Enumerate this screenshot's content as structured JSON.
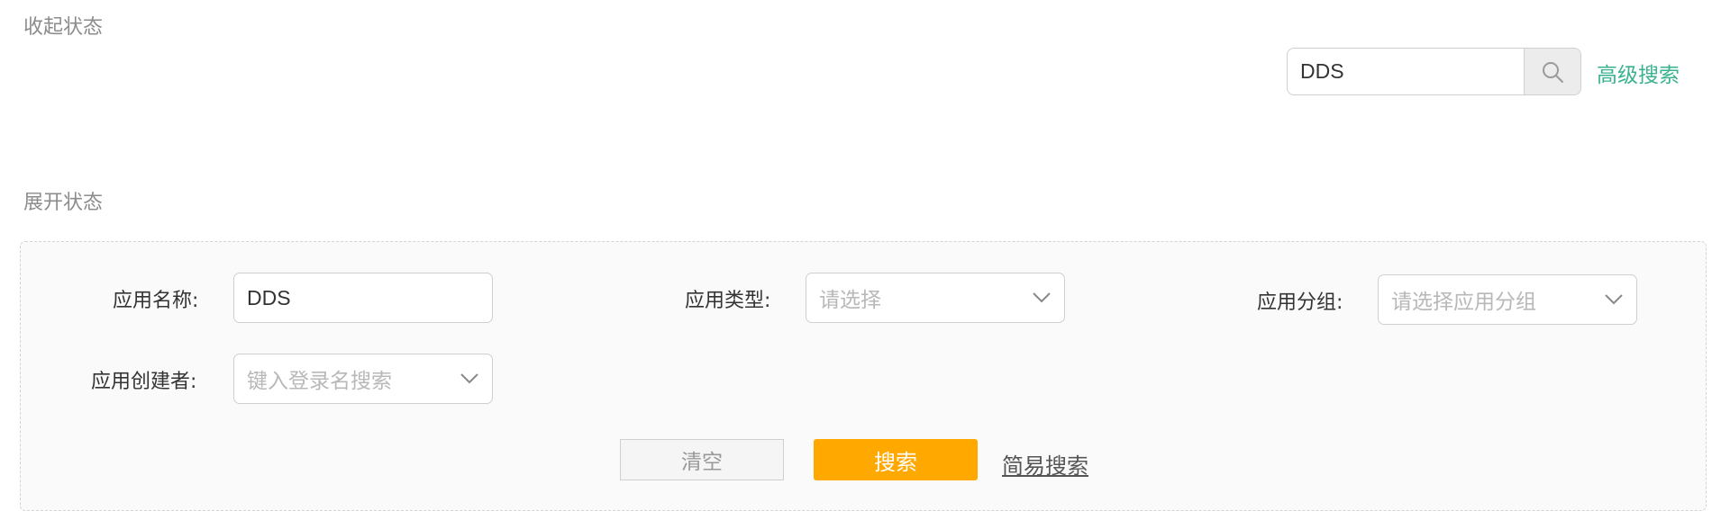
{
  "collapsed": {
    "title": "收起状态",
    "search_value": "DDS",
    "advanced_link": "高级搜索",
    "search_icon": "search-icon"
  },
  "expanded": {
    "title": "展开状态",
    "fields": {
      "app_name": {
        "label": "应用名称:",
        "value": "DDS"
      },
      "app_type": {
        "label": "应用类型:",
        "placeholder": "请选择"
      },
      "app_group": {
        "label": "应用分组:",
        "placeholder": "请选择应用分组"
      },
      "app_creator": {
        "label": "应用创建者:",
        "placeholder": "键入登录名搜索"
      }
    },
    "buttons": {
      "clear": "清空",
      "search": "搜索",
      "simple_link": "简易搜索"
    }
  },
  "colors": {
    "accent_green": "#3bb28f",
    "primary_orange": "#ffa800",
    "panel_bg": "#fafafa"
  }
}
